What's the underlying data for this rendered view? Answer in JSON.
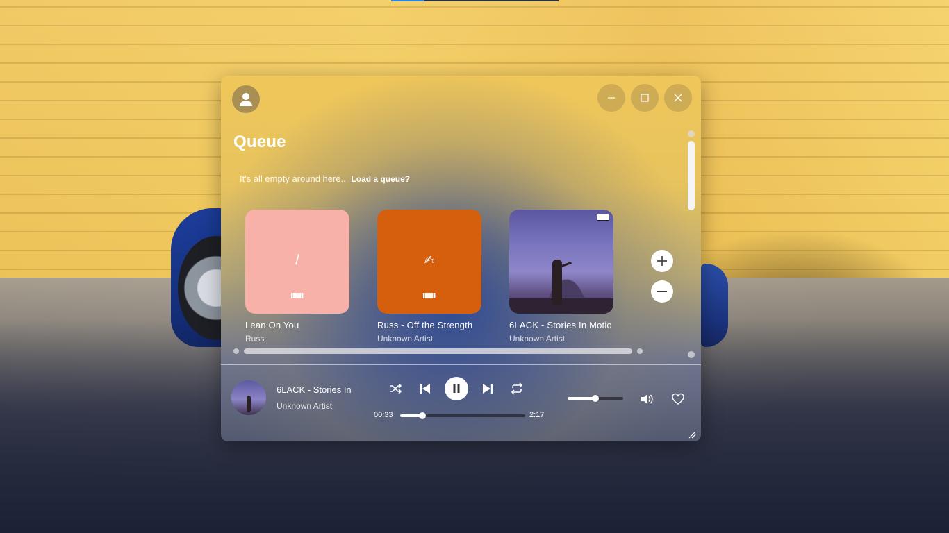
{
  "window": {
    "title": "Queue",
    "controls": {
      "minimize_icon": "minimize-icon",
      "maximize_icon": "maximize-icon",
      "close_icon": "close-icon"
    }
  },
  "queue": {
    "empty_text": "It's all empty around here..",
    "load_link": "Load a queue?"
  },
  "cards": [
    {
      "title": "Lean On You",
      "artist": "Russ",
      "cover_color": "#f8b1a8",
      "glyph": "/"
    },
    {
      "title": "Russ - Off the Strength",
      "artist": "Unknown Artist",
      "cover_color": "#d65f0e",
      "glyph": "✍"
    },
    {
      "title": "6LACK - Stories In Motio",
      "artist": "Unknown Artist",
      "cover_color": "#6f6bb3",
      "glyph": ""
    }
  ],
  "now_playing": {
    "title": "6LACK - Stories In",
    "artist": "Unknown Artist",
    "elapsed": "00:33",
    "duration": "2:17",
    "progress": 0.18,
    "volume": 0.5
  },
  "colors": {
    "accent": "#ffffff",
    "wall": "#ecc053"
  }
}
